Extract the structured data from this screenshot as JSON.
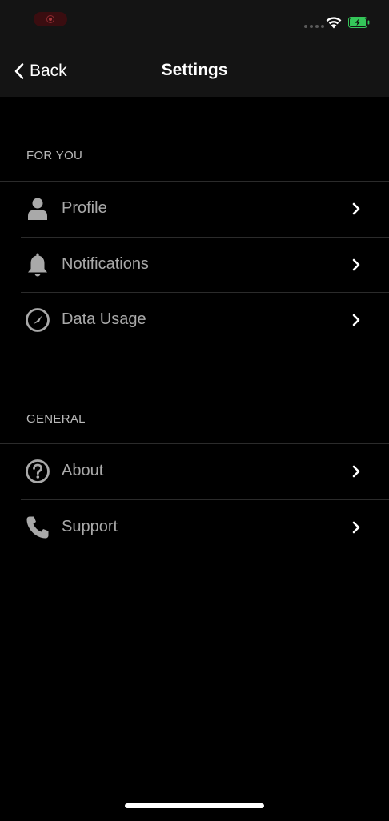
{
  "nav": {
    "back_label": "Back",
    "title": "Settings"
  },
  "sections": [
    {
      "header": "FOR YOU",
      "items": [
        {
          "label": "Profile",
          "icon": "person-icon"
        },
        {
          "label": "Notifications",
          "icon": "bell-icon"
        },
        {
          "label": "Data Usage",
          "icon": "gauge-icon"
        }
      ]
    },
    {
      "header": "GENERAL",
      "items": [
        {
          "label": "About",
          "icon": "question-circle-icon"
        },
        {
          "label": "Support",
          "icon": "phone-icon"
        }
      ]
    }
  ],
  "status": {
    "battery_color": "#34c759",
    "battery_charging": true
  },
  "colors": {
    "background": "#000000",
    "bar_background": "#141414",
    "label": "#a9a9a9",
    "header": "#b9b9b9"
  }
}
